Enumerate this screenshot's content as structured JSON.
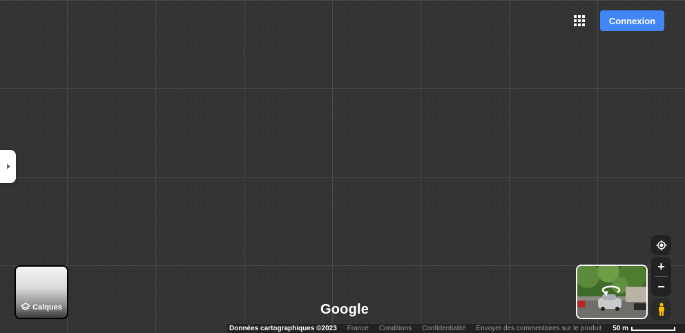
{
  "header": {
    "apps_icon": "apps-grid-icon",
    "signin_label": "Connexion"
  },
  "sidebar": {
    "toggle_icon": "chevron-right-icon"
  },
  "layers": {
    "icon": "layers-icon",
    "label": "Calques"
  },
  "branding": {
    "logo_text": "Google"
  },
  "footer": {
    "map_data": "Données cartographiques ©2023",
    "country": "France",
    "terms": "Conditions",
    "privacy": "Confidentialité",
    "feedback": "Envoyer des commentaires sur le produit",
    "scale_label": "50 m"
  },
  "controls": {
    "locate_icon": "my-location-icon",
    "zoom_in_label": "+",
    "zoom_out_label": "−",
    "pegman_icon": "pegman-icon",
    "streetview_icon": "street-view-thumbnail"
  },
  "colors": {
    "map_background": "#333333",
    "signin_blue": "#4285f4",
    "control_background": "#222222",
    "pegman_yellow": "#fbbc04"
  }
}
